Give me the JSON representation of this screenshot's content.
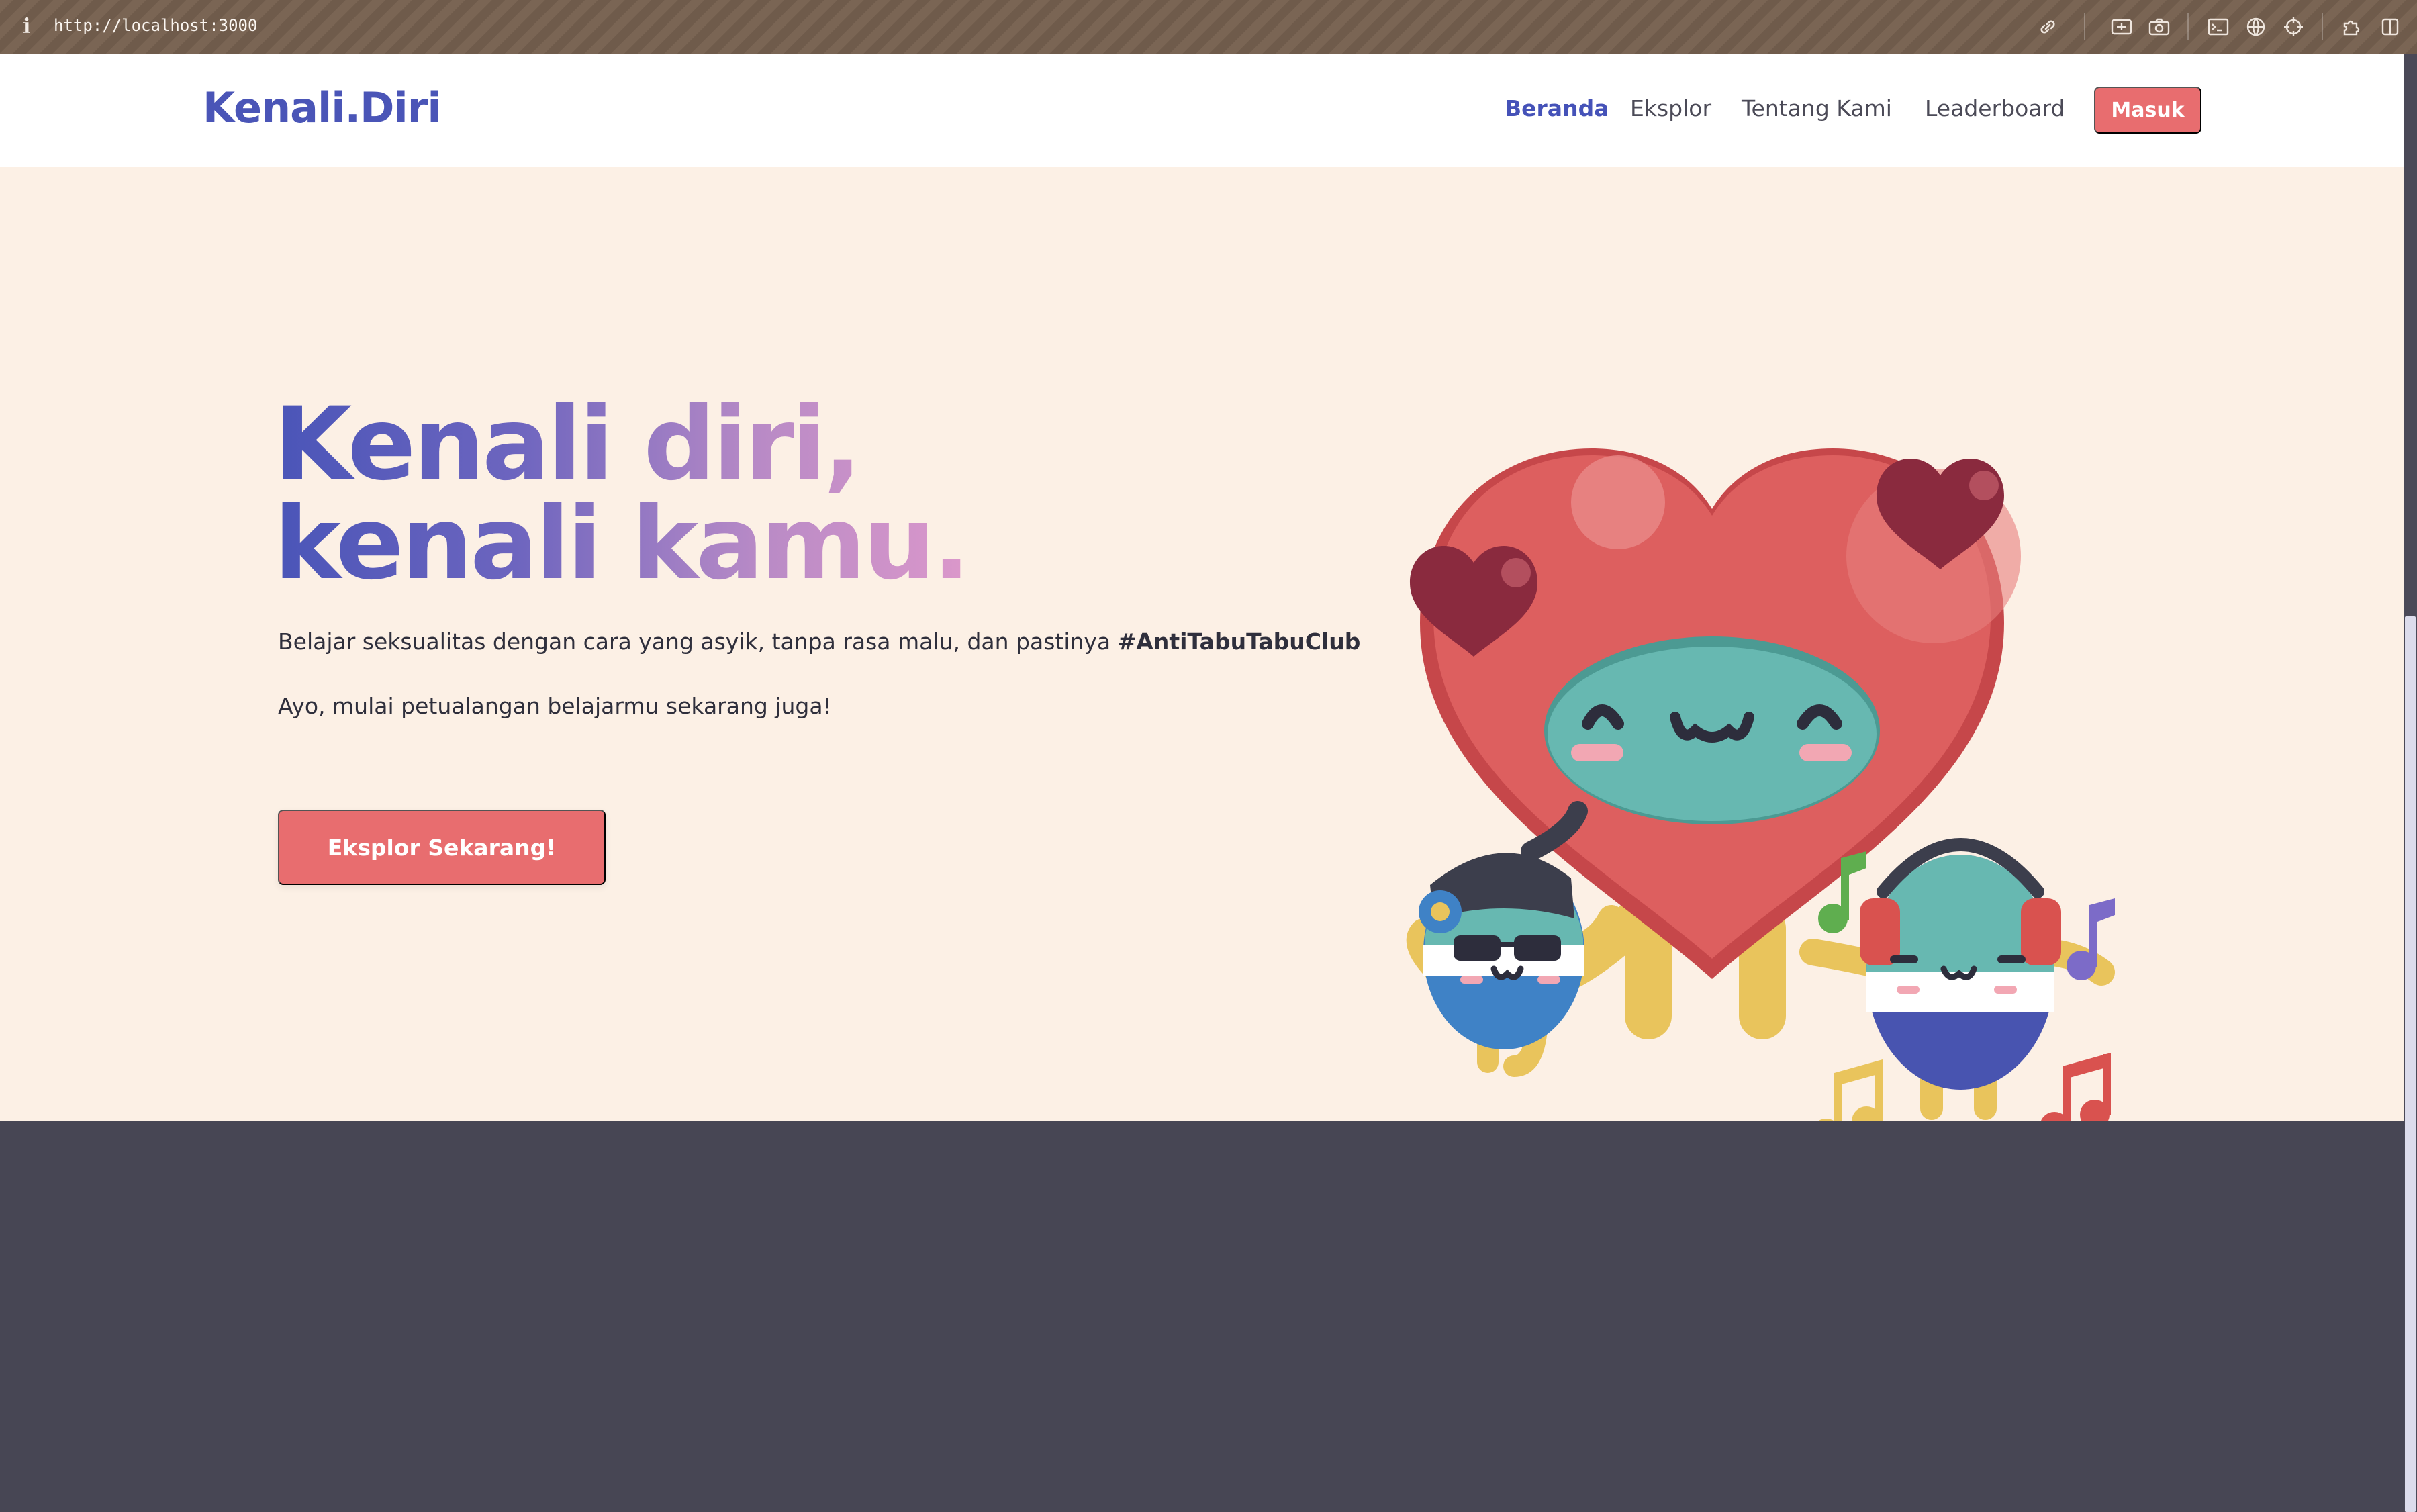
{
  "browser": {
    "info_glyph": "i",
    "url": "http://localhost:3000",
    "toolbar_icons": [
      "link-icon",
      "screenshot-area-icon",
      "camera-icon",
      "terminal-icon",
      "globe-icon",
      "crosshair-icon",
      "extension-icon",
      "sidebar-icon"
    ]
  },
  "navbar": {
    "brand": "Kenali.Diri",
    "links": [
      {
        "label": "Beranda",
        "active": true
      },
      {
        "label": "Eksplor",
        "active": false
      },
      {
        "label": "Tentang Kami",
        "active": false
      },
      {
        "label": "Leaderboard",
        "active": false
      }
    ],
    "login_label": "Masuk"
  },
  "hero": {
    "title_line1": "Kenali diri,",
    "title_line2": "kenali kamu.",
    "paragraph1_text": "Belajar seksualitas dengan cara yang asyik, tanpa rasa malu, dan pastinya ",
    "paragraph1_hashtag": "#AntiTabuTabuClub",
    "paragraph2": "Ayo, mulai petualangan belajarmu sekarang juga!",
    "cta_label": "Eksplor Sekarang!"
  },
  "colors": {
    "brand": "#4a55b7",
    "accent": "#e86d6f",
    "hero_bg": "#fcf0e5",
    "dark_bg": "#474654"
  }
}
